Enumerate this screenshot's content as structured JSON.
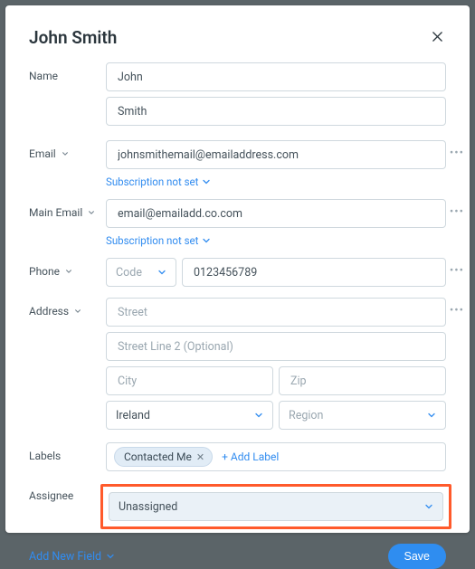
{
  "header": {
    "title": "John Smith"
  },
  "labels": {
    "name": "Name",
    "email": "Email",
    "main_email": "Main Email",
    "phone": "Phone",
    "address": "Address",
    "labels": "Labels",
    "assignee": "Assignee"
  },
  "name": {
    "first": "John",
    "last": "Smith"
  },
  "email": {
    "value": "johnsmithemail@emailaddress.com",
    "subscription": "Subscription not set"
  },
  "main_email": {
    "value": "email@emailadd.co.com",
    "subscription": "Subscription not set"
  },
  "phone": {
    "code_placeholder": "Code",
    "number": "0123456789"
  },
  "address": {
    "street_placeholder": "Street",
    "street2_placeholder": "Street Line 2 (Optional)",
    "city_placeholder": "City",
    "zip_placeholder": "Zip",
    "country": "Ireland",
    "region_placeholder": "Region"
  },
  "tags": {
    "chip": "Contacted Me",
    "add": "+ Add Label"
  },
  "assignee": {
    "value": "Unassigned"
  },
  "footer": {
    "add_field": "Add New Field",
    "save": "Save"
  }
}
